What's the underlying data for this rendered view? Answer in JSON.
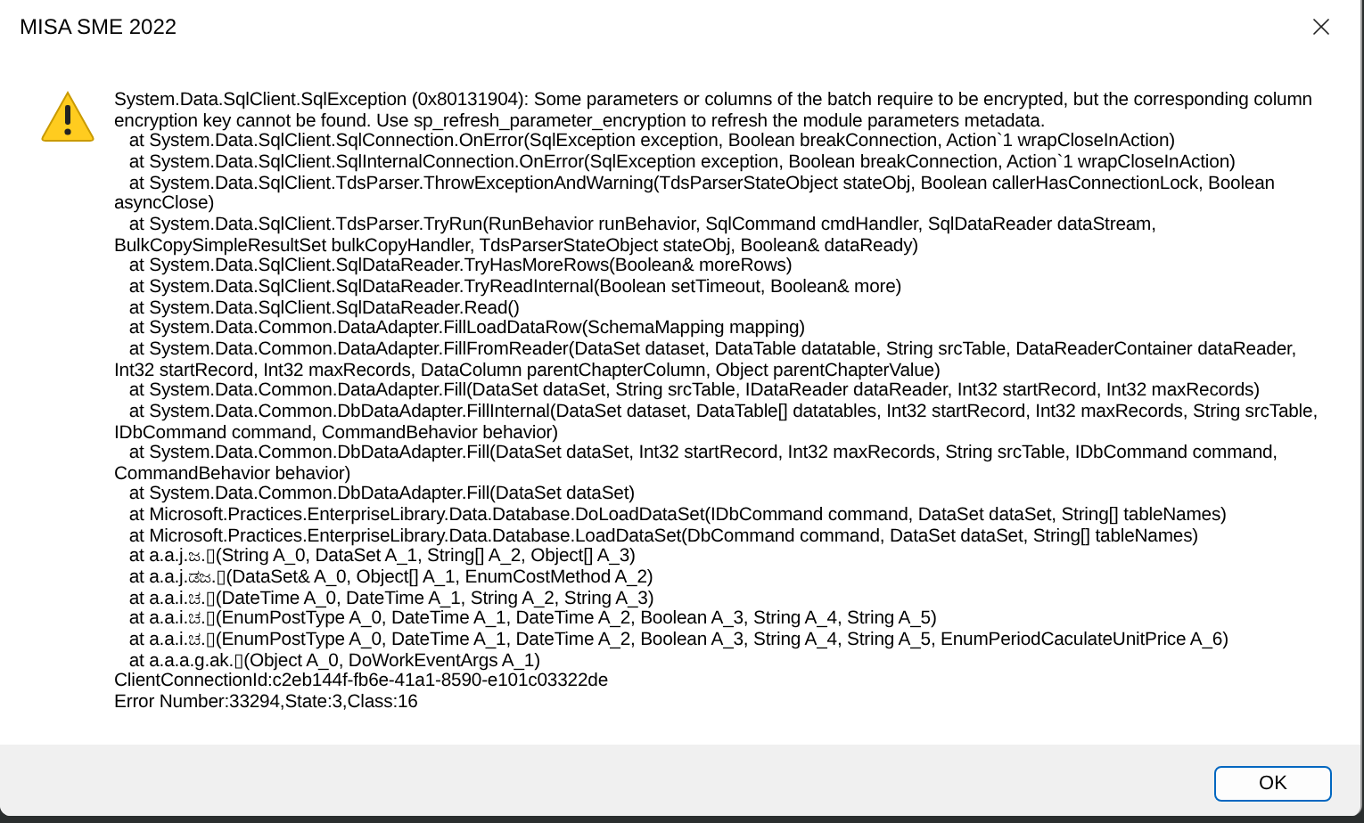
{
  "window": {
    "title": "MISA SME 2022"
  },
  "message": {
    "lines": [
      "System.Data.SqlClient.SqlException (0x80131904): Some parameters or columns of the batch require to be encrypted, but the corresponding column",
      "encryption key cannot be found. Use sp_refresh_parameter_encryption to refresh the module parameters metadata.",
      "   at System.Data.SqlClient.SqlConnection.OnError(SqlException exception, Boolean breakConnection, Action`1 wrapCloseInAction)",
      "   at System.Data.SqlClient.SqlInternalConnection.OnError(SqlException exception, Boolean breakConnection, Action`1 wrapCloseInAction)",
      "   at System.Data.SqlClient.TdsParser.ThrowExceptionAndWarning(TdsParserStateObject stateObj, Boolean callerHasConnectionLock, Boolean",
      "asyncClose)",
      "   at System.Data.SqlClient.TdsParser.TryRun(RunBehavior runBehavior, SqlCommand cmdHandler, SqlDataReader dataStream,",
      "BulkCopySimpleResultSet bulkCopyHandler, TdsParserStateObject stateObj, Boolean& dataReady)",
      "   at System.Data.SqlClient.SqlDataReader.TryHasMoreRows(Boolean& moreRows)",
      "   at System.Data.SqlClient.SqlDataReader.TryReadInternal(Boolean setTimeout, Boolean& more)",
      "   at System.Data.SqlClient.SqlDataReader.Read()",
      "   at System.Data.Common.DataAdapter.FillLoadDataRow(SchemaMapping mapping)",
      "   at System.Data.Common.DataAdapter.FillFromReader(DataSet dataset, DataTable datatable, String srcTable, DataReaderContainer dataReader,",
      "Int32 startRecord, Int32 maxRecords, DataColumn parentChapterColumn, Object parentChapterValue)",
      "   at System.Data.Common.DataAdapter.Fill(DataSet dataSet, String srcTable, IDataReader dataReader, Int32 startRecord, Int32 maxRecords)",
      "   at System.Data.Common.DbDataAdapter.FillInternal(DataSet dataset, DataTable[] datatables, Int32 startRecord, Int32 maxRecords, String srcTable,",
      "IDbCommand command, CommandBehavior behavior)",
      "   at System.Data.Common.DbDataAdapter.Fill(DataSet dataSet, Int32 startRecord, Int32 maxRecords, String srcTable, IDbCommand command,",
      "CommandBehavior behavior)",
      "   at System.Data.Common.DbDataAdapter.Fill(DataSet dataSet)",
      "   at Microsoft.Practices.EnterpriseLibrary.Data.Database.DoLoadDataSet(IDbCommand command, DataSet dataSet, String[] tableNames)",
      "   at Microsoft.Practices.EnterpriseLibrary.Data.Database.LoadDataSet(DbCommand command, DataSet dataSet, String[] tableNames)",
      "   at a.a.j.ಜ.▯(String A_0, DataSet A_1, String[] A_2, Object[] A_3)",
      "   at a.a.j.ಡಜ.▯(DataSet& A_0, Object[] A_1, EnumCostMethod A_2)",
      "   at a.a.i.ಚ.▯(DateTime A_0, DateTime A_1, String A_2, String A_3)",
      "   at a.a.i.ಚ.▯(EnumPostType A_0, DateTime A_1, DateTime A_2, Boolean A_3, String A_4, String A_5)",
      "   at a.a.i.ಚ.▯(EnumPostType A_0, DateTime A_1, DateTime A_2, Boolean A_3, String A_4, String A_5, EnumPeriodCaculateUnitPrice A_6)",
      "   at a.a.a.g.ak.▯(Object A_0, DoWorkEventArgs A_1)",
      "ClientConnectionId:c2eb144f-fb6e-41a1-8590-e101c03322de",
      "Error Number:33294,State:3,Class:16"
    ]
  },
  "buttons": [
    "OK"
  ]
}
